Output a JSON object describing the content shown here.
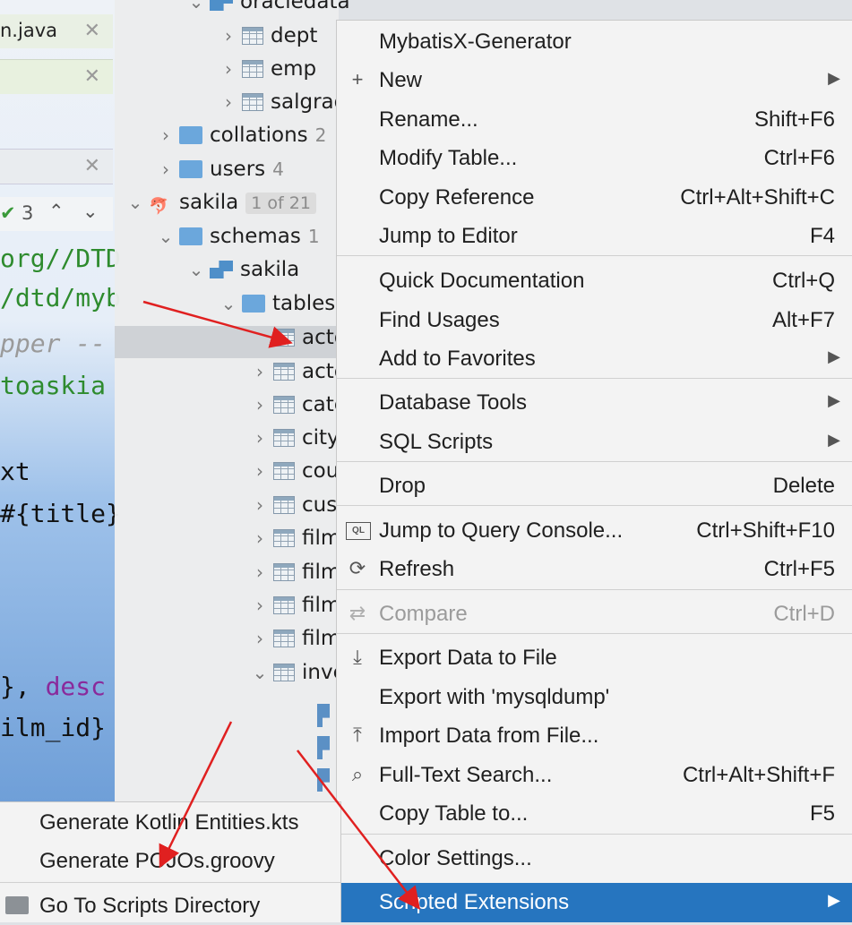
{
  "editor": {
    "tabs": [
      {
        "label": "n.java",
        "close": "✕"
      },
      {
        "label": "",
        "close": "✕"
      },
      {
        "label": "",
        "close": "✕"
      }
    ],
    "inspection": {
      "check": "✔",
      "count": "3",
      "up": "⌃",
      "down": "⌄"
    },
    "code_lines": [
      {
        "text": "org//DTD",
        "color": "#2e8b2e"
      },
      {
        "text": "/dtd/myb",
        "color": "#2e8b2e"
      },
      {
        "text": "pper --",
        "color": "#9a9a9a"
      },
      {
        "text": "toaskia",
        "color": "#2e8b2e"
      },
      {
        "text": "",
        "color": "#111"
      },
      {
        "text": "xt",
        "color": "#111"
      },
      {
        "text": "#{title}",
        "color": "#111"
      },
      {
        "text": "",
        "color": "#111"
      },
      {
        "text": "",
        "color": "#111"
      },
      {
        "text": "}, desc",
        "color": "#111"
      },
      {
        "text": "ilm_id}",
        "color": "#111"
      }
    ]
  },
  "tree": {
    "rows": [
      {
        "label": "oracledata",
        "icon": "schema-icon",
        "chevron": "⌄",
        "indent": 2
      },
      {
        "label": "dept",
        "icon": "table-icon",
        "chevron": "›",
        "indent": 3
      },
      {
        "label": "emp",
        "icon": "table-icon",
        "chevron": "›",
        "indent": 3
      },
      {
        "label": "salgrade",
        "icon": "table-icon",
        "chevron": "›",
        "indent": 3
      },
      {
        "label": "collations",
        "icon": "folder-icon",
        "chevron": "›",
        "indent": 1,
        "muted": "2"
      },
      {
        "label": "users",
        "icon": "folder-icon",
        "chevron": "›",
        "indent": 1,
        "muted": "4"
      },
      {
        "label": "sakila",
        "icon": "mysql-icon",
        "chevron": "⌄",
        "indent": 0,
        "pill": "1 of 21"
      },
      {
        "label": "schemas",
        "icon": "folder-icon",
        "chevron": "⌄",
        "indent": 1,
        "muted": "1"
      },
      {
        "label": "sakila",
        "icon": "schema-icon",
        "chevron": "⌄",
        "indent": 2
      },
      {
        "label": "tables",
        "icon": "folder-icon",
        "chevron": "⌄",
        "indent": 3
      },
      {
        "label": "actor",
        "icon": "table-icon",
        "chevron": "",
        "indent": 4,
        "selected": true
      },
      {
        "label": "actor_info",
        "icon": "table-icon",
        "chevron": "›",
        "indent": 4
      },
      {
        "label": "category",
        "icon": "table-icon",
        "chevron": "›",
        "indent": 4
      },
      {
        "label": "city",
        "icon": "table-icon",
        "chevron": "›",
        "indent": 4
      },
      {
        "label": "country",
        "icon": "table-icon",
        "chevron": "›",
        "indent": 4
      },
      {
        "label": "customer",
        "icon": "table-icon",
        "chevron": "›",
        "indent": 4
      },
      {
        "label": "film",
        "icon": "table-icon",
        "chevron": "›",
        "indent": 4
      },
      {
        "label": "film_actor",
        "icon": "table-icon",
        "chevron": "›",
        "indent": 4
      },
      {
        "label": "film_category",
        "icon": "table-icon",
        "chevron": "›",
        "indent": 4
      },
      {
        "label": "film_text",
        "icon": "table-icon",
        "chevron": "›",
        "indent": 4
      },
      {
        "label": "inventory",
        "icon": "table-icon",
        "chevron": "⌄",
        "indent": 4
      }
    ]
  },
  "context_menu": {
    "items": [
      {
        "label": "MybatisX-Generator",
        "shortcut": "",
        "icon": "",
        "submenu": false
      },
      {
        "label": "New",
        "shortcut": "",
        "icon": "+",
        "submenu": true
      },
      {
        "label": "Rename...",
        "shortcut": "Shift+F6",
        "icon": "",
        "submenu": false
      },
      {
        "label": "Modify Table...",
        "shortcut": "Ctrl+F6",
        "icon": "",
        "submenu": false
      },
      {
        "label": "Copy Reference",
        "shortcut": "Ctrl+Alt+Shift+C",
        "icon": "",
        "submenu": false
      },
      {
        "label": "Jump to Editor",
        "shortcut": "F4",
        "icon": "",
        "submenu": false,
        "sep_after": true
      },
      {
        "label": "Quick Documentation",
        "shortcut": "Ctrl+Q",
        "icon": "",
        "submenu": false
      },
      {
        "label": "Find Usages",
        "shortcut": "Alt+F7",
        "icon": "",
        "submenu": false
      },
      {
        "label": "Add to Favorites",
        "shortcut": "",
        "icon": "",
        "submenu": true,
        "sep_after": true
      },
      {
        "label": "Database Tools",
        "shortcut": "",
        "icon": "",
        "submenu": true
      },
      {
        "label": "SQL Scripts",
        "shortcut": "",
        "icon": "",
        "submenu": true,
        "sep_after": true
      },
      {
        "label": "Drop",
        "shortcut": "Delete",
        "icon": "",
        "submenu": false,
        "sep_after": true
      },
      {
        "label": "Jump to Query Console...",
        "shortcut": "Ctrl+Shift+F10",
        "icon": "QL",
        "submenu": false
      },
      {
        "label": "Refresh",
        "shortcut": "Ctrl+F5",
        "icon": "⟳",
        "submenu": false,
        "sep_after": true
      },
      {
        "label": "Compare",
        "shortcut": "Ctrl+D",
        "icon": "⇄",
        "submenu": false,
        "disabled": true,
        "sep_after": true
      },
      {
        "label": "Export Data to File",
        "shortcut": "",
        "icon": "⤓",
        "submenu": false
      },
      {
        "label": "Export with 'mysqldump'",
        "shortcut": "",
        "icon": "",
        "submenu": false
      },
      {
        "label": "Import Data from File...",
        "shortcut": "",
        "icon": "⤒",
        "submenu": false
      },
      {
        "label": "Full-Text Search...",
        "shortcut": "Ctrl+Alt+Shift+F",
        "icon": "⌕",
        "submenu": false
      },
      {
        "label": "Copy Table to...",
        "shortcut": "F5",
        "icon": "",
        "submenu": false,
        "sep_after": true
      },
      {
        "label": "Color Settings...",
        "shortcut": "",
        "icon": "",
        "submenu": false
      },
      {
        "label": "Scripted Extensions",
        "shortcut": "",
        "icon": "",
        "submenu": true,
        "active": true
      }
    ]
  },
  "submenu": {
    "items": [
      {
        "label": "Generate Kotlin Entities.kts",
        "icon": ""
      },
      {
        "label": "Generate POJOs.groovy",
        "icon": "",
        "sep_after": true
      },
      {
        "label": "Go To Scripts Directory",
        "icon": "folder"
      }
    ]
  },
  "colors": {
    "accent": "#2675bf",
    "annotation_arrow": "#e02020"
  }
}
